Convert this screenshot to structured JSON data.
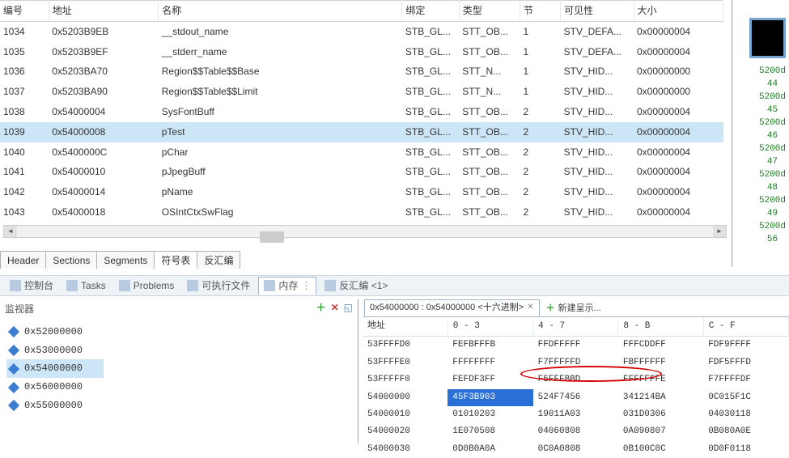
{
  "sym_table": {
    "headers": [
      "编号",
      "地址",
      "名称",
      "绑定",
      "类型",
      "节",
      "可见性",
      "大小"
    ],
    "selected_index": 5,
    "rows": [
      {
        "idx": "1034",
        "addr": "0x5203B9EB",
        "name": "__stdout_name",
        "bind": "STB_GL...",
        "type": "STT_OB...",
        "sec": "1",
        "vis": "STV_DEFA...",
        "size": "0x00000004"
      },
      {
        "idx": "1035",
        "addr": "0x5203B9EF",
        "name": "__stderr_name",
        "bind": "STB_GL...",
        "type": "STT_OB...",
        "sec": "1",
        "vis": "STV_DEFA...",
        "size": "0x00000004"
      },
      {
        "idx": "1036",
        "addr": "0x5203BA70",
        "name": "Region$$Table$$Base",
        "bind": "STB_GL...",
        "type": "STT_N...",
        "sec": "1",
        "vis": "STV_HID...",
        "size": "0x00000000"
      },
      {
        "idx": "1037",
        "addr": "0x5203BA90",
        "name": "Region$$Table$$Limit",
        "bind": "STB_GL...",
        "type": "STT_N...",
        "sec": "1",
        "vis": "STV_HID...",
        "size": "0x00000000"
      },
      {
        "idx": "1038",
        "addr": "0x54000004",
        "name": "SysFontBuff",
        "bind": "STB_GL...",
        "type": "STT_OB...",
        "sec": "2",
        "vis": "STV_HID...",
        "size": "0x00000004"
      },
      {
        "idx": "1039",
        "addr": "0x54000008",
        "name": "pTest",
        "bind": "STB_GL...",
        "type": "STT_OB...",
        "sec": "2",
        "vis": "STV_HID...",
        "size": "0x00000004"
      },
      {
        "idx": "1040",
        "addr": "0x5400000C",
        "name": "pChar",
        "bind": "STB_GL...",
        "type": "STT_OB...",
        "sec": "2",
        "vis": "STV_HID...",
        "size": "0x00000004"
      },
      {
        "idx": "1041",
        "addr": "0x54000010",
        "name": "pJpegBuff",
        "bind": "STB_GL...",
        "type": "STT_OB...",
        "sec": "2",
        "vis": "STV_HID...",
        "size": "0x00000004"
      },
      {
        "idx": "1042",
        "addr": "0x54000014",
        "name": "pName",
        "bind": "STB_GL...",
        "type": "STT_OB...",
        "sec": "2",
        "vis": "STV_HID...",
        "size": "0x00000004"
      },
      {
        "idx": "1043",
        "addr": "0x54000018",
        "name": "OSIntCtxSwFlag",
        "bind": "STB_GL...",
        "type": "STT_OB...",
        "sec": "2",
        "vis": "STV_HID...",
        "size": "0x00000004"
      }
    ],
    "tabs": [
      "Header",
      "Sections",
      "Segments",
      "符号表",
      "反汇编"
    ],
    "active_tab": 3
  },
  "side_labels": [
    "5200d",
    "44",
    "5200d",
    "45",
    "5200d",
    "46",
    "5200d",
    "47",
    "5200d",
    "48",
    "5200d",
    "49",
    "5200d",
    "56"
  ],
  "views_bar": {
    "items": [
      {
        "label": "控制台"
      },
      {
        "label": "Tasks"
      },
      {
        "label": "Problems"
      },
      {
        "label": "可执行文件"
      },
      {
        "label": "内存",
        "decorated": true,
        "active": true
      },
      {
        "label": "反汇编 <1>"
      }
    ]
  },
  "monitor": {
    "title": "监视器",
    "selected_index": 2,
    "items": [
      "0x52000000",
      "0x53000000",
      "0x54000000",
      "0x56000000",
      "0x55000000"
    ]
  },
  "memory": {
    "tab_title": "0x54000000 : 0x54000000 <十六进制>",
    "new_tab_label": "新建呈示...",
    "headers": [
      "地址",
      "0 - 3",
      "4 - 7",
      "8 - B",
      "C - F"
    ],
    "rows": [
      {
        "addr": "53FFFFD0",
        "c0": "FEFBFFFB",
        "c1": "FFDFFFFF",
        "c2": "FFFCDDFF",
        "c3": "FDF9FFFF"
      },
      {
        "addr": "53FFFFE0",
        "c0": "FFFFFFFF",
        "c1": "F7FFFFFD",
        "c2": "FBFFFFFF",
        "c3": "FDF5FFFD"
      },
      {
        "addr": "53FFFFF0",
        "c0": "FEFDF3FF",
        "c1": "F5FFFBBD",
        "c2": "FFFFFFFE",
        "c3": "F7FFFFDF"
      },
      {
        "addr": "54000000",
        "c0": "45F3B903",
        "c1": "524F7456",
        "c2": "341214BA",
        "c3": "0C015F1C"
      },
      {
        "addr": "54000010",
        "c0": "01010203",
        "c1": "19011A03",
        "c2": "031D0306",
        "c3": "04030118"
      },
      {
        "addr": "54000020",
        "c0": "1E070508",
        "c1": "04060808",
        "c2": "0A090807",
        "c3": "0B080A0E"
      },
      {
        "addr": "54000030",
        "c0": "0D0B0A0A",
        "c1": "0C0A0808",
        "c2": "0B100C0C",
        "c3": "0D0F0118"
      }
    ],
    "highlighted": {
      "row": 3,
      "col": "c0"
    }
  }
}
